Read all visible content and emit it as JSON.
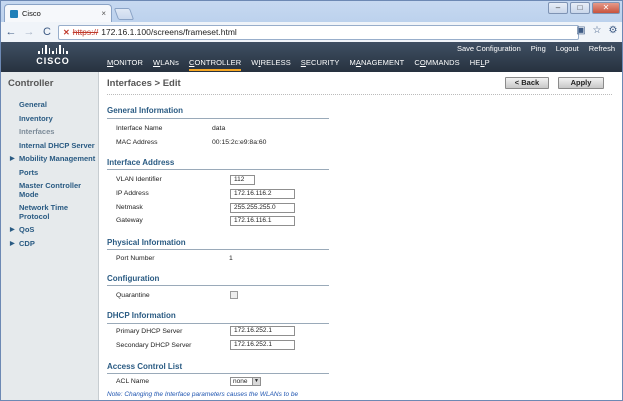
{
  "browser": {
    "tab_title": "Cisco",
    "tab_close": "×",
    "url_scheme": "https://",
    "url_rest": "172.16.1.100/screens/frameset.html",
    "back": "←",
    "forward": "→",
    "reload": "C",
    "minimize": "–",
    "maximize": "□",
    "close": "✕",
    "page_icon": "▣",
    "star": "☆",
    "wrench": "⚙"
  },
  "header": {
    "logo_text": "CISCO",
    "top_links": [
      "Save Configuration",
      "Ping",
      "Logout",
      "Refresh"
    ],
    "nav": [
      {
        "pre": "",
        "u": "M",
        "post": "ONITOR",
        "active": false
      },
      {
        "pre": "",
        "u": "W",
        "post": "LANs",
        "active": false
      },
      {
        "pre": "",
        "u": "C",
        "post": "ONTROLLER",
        "active": true
      },
      {
        "pre": "W",
        "u": "I",
        "post": "RELESS",
        "active": false
      },
      {
        "pre": "",
        "u": "S",
        "post": "ECURITY",
        "active": false
      },
      {
        "pre": "M",
        "u": "A",
        "post": "NAGEMENT",
        "active": false
      },
      {
        "pre": "C",
        "u": "O",
        "post": "MMANDS",
        "active": false
      },
      {
        "pre": "HE",
        "u": "L",
        "post": "P",
        "active": false
      }
    ]
  },
  "sidebar": {
    "title": "Controller",
    "items": [
      {
        "label": "General",
        "arrow": ""
      },
      {
        "label": "Inventory",
        "arrow": ""
      },
      {
        "label": "Interfaces",
        "arrow": ""
      },
      {
        "label": "Internal DHCP Server",
        "arrow": ""
      },
      {
        "label": "Mobility Management",
        "arrow": "▶"
      },
      {
        "label": "Ports",
        "arrow": ""
      },
      {
        "label": "Master Controller Mode",
        "arrow": ""
      },
      {
        "label": "Network Time Protocol",
        "arrow": ""
      },
      {
        "label": "QoS",
        "arrow": "▶"
      },
      {
        "label": "CDP",
        "arrow": "▶"
      }
    ]
  },
  "page": {
    "title": "Interfaces > Edit",
    "back_button": "< Back",
    "apply_button": "Apply",
    "general": {
      "title": "General Information",
      "interface_name_label": "Interface Name",
      "interface_name": "data",
      "mac_label": "MAC Address",
      "mac": "00:15:2c:e9:8a:60"
    },
    "address": {
      "title": "Interface Address",
      "vlan_label": "VLAN Identifier",
      "vlan": "112",
      "ip_label": "IP Address",
      "ip": "172.16.116.2",
      "netmask_label": "Netmask",
      "netmask": "255.255.255.0",
      "gateway_label": "Gateway",
      "gateway": "172.16.116.1"
    },
    "physical": {
      "title": "Physical Information",
      "port_label": "Port Number",
      "port": "1"
    },
    "config": {
      "title": "Configuration",
      "quarantine_label": "Quarantine"
    },
    "dhcp": {
      "title": "DHCP Information",
      "primary_label": "Primary DHCP Server",
      "primary": "172.16.252.1",
      "secondary_label": "Secondary DHCP Server",
      "secondary": "172.16.252.1"
    },
    "acl": {
      "title": "Access Control List",
      "acl_label": "ACL Name",
      "acl_value": "none"
    },
    "note": "Note: Changing the Interface parameters causes the WLANs to be"
  }
}
